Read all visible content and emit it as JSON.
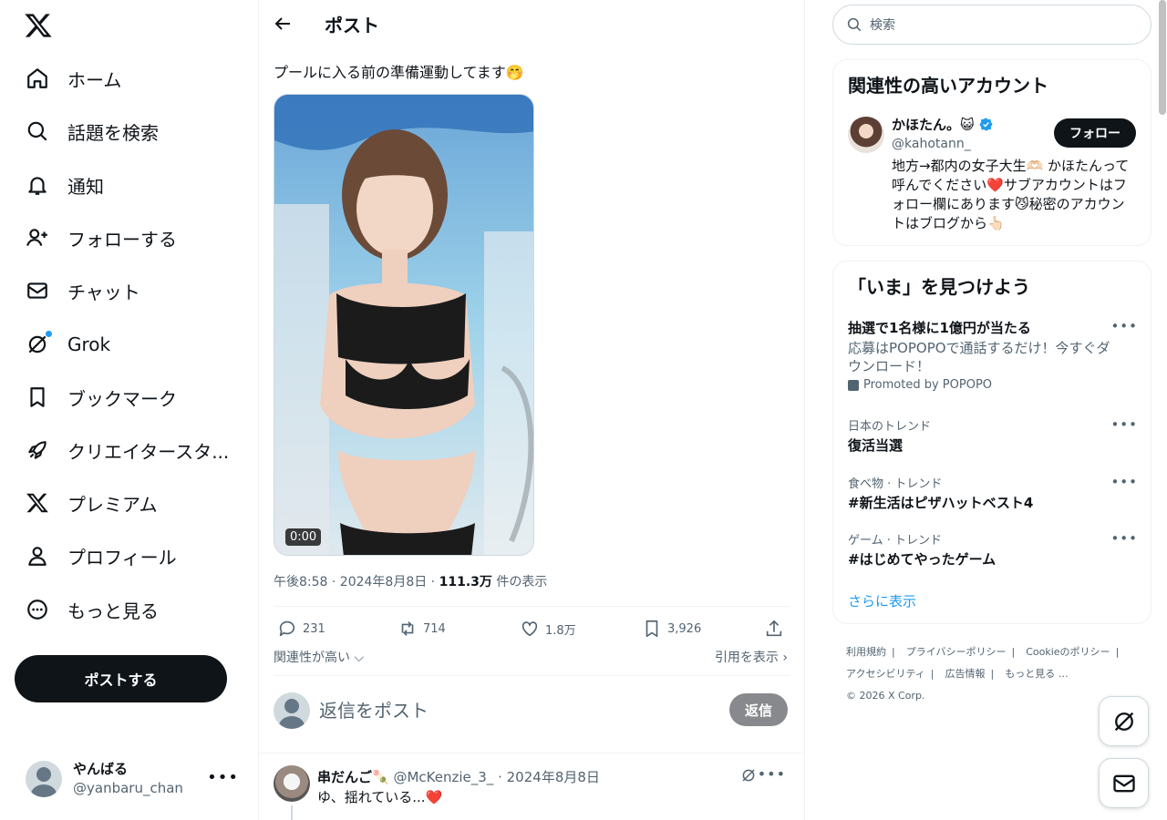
{
  "nav": {
    "items": [
      {
        "label": "ホーム",
        "icon": "home-icon"
      },
      {
        "label": "話題を検索",
        "icon": "search-icon"
      },
      {
        "label": "通知",
        "icon": "bell-icon"
      },
      {
        "label": "フォローする",
        "icon": "follow-icon"
      },
      {
        "label": "チャット",
        "icon": "mail-icon"
      },
      {
        "label": "Grok",
        "icon": "grok-icon"
      },
      {
        "label": "ブックマーク",
        "icon": "bookmark-icon"
      },
      {
        "label": "クリエイタースタ...",
        "icon": "rocket-icon"
      },
      {
        "label": "プレミアム",
        "icon": "x-logo-icon"
      },
      {
        "label": "プロフィール",
        "icon": "person-icon"
      },
      {
        "label": "もっと見る",
        "icon": "more-circle-icon"
      }
    ],
    "post_button": "ポストする"
  },
  "account": {
    "name": "やんばる",
    "handle": "@yanbaru_chan"
  },
  "main": {
    "title": "ポスト",
    "post_text": "プールに入る前の準備運動してます🤭",
    "video_time": "0:00",
    "meta_time": "午後8:58 · 2024年8月8日 · ",
    "meta_views": "111.3万",
    "meta_views_suffix": " 件の表示",
    "actions": {
      "replies": "231",
      "reposts": "714",
      "likes": "1.8万",
      "bookmarks": "3,926"
    },
    "relevance": "関連性が高い",
    "quotes": "引用を表示",
    "reply_placeholder": "返信をポスト",
    "reply_button": "返信"
  },
  "reply": {
    "name": "串だんご🍡",
    "handle": "@McKenzie_3_",
    "date": "2024年8月8日",
    "text": "ゆ、揺れている...❤️"
  },
  "sidebar": {
    "search_placeholder": "検索",
    "recommended_title": "関連性の高いアカウント",
    "rec": {
      "name": "かほたん。😺",
      "handle": "@kahotann_",
      "bio": "地方→都内の女子大生🫶🏻 かほたんって呼んでください❤️サブアカウントはフォロー欄にあります😼秘密のアカウントはブログから👆🏻",
      "follow": "フォロー"
    },
    "trends_title": "「いま」を見つけよう",
    "trends": [
      {
        "category": "",
        "name": "抽選で1名様に1億円が当たる",
        "desc": "応募はPOPOPOで通話するだけ！今すぐダウンロード！",
        "promo": "Promoted by POPOPO"
      },
      {
        "category": "日本のトレンド",
        "name": "復活当選"
      },
      {
        "category": "食べ物 · トレンド",
        "name": "#新生活はピザハットベスト4"
      },
      {
        "category": "ゲーム · トレンド",
        "name": "#はじめてやったゲーム"
      }
    ],
    "show_more": "さらに表示"
  },
  "footer": {
    "links": [
      "利用規約",
      "プライバシーポリシー",
      "Cookieのポリシー",
      "アクセシビリティ",
      "広告情報",
      "もっと見る …"
    ],
    "copyright": "© 2026 X Corp."
  },
  "colors": {
    "accent": "#1d9bf0",
    "text": "#0f1419",
    "muted": "#536471",
    "border": "#eff3f4"
  }
}
